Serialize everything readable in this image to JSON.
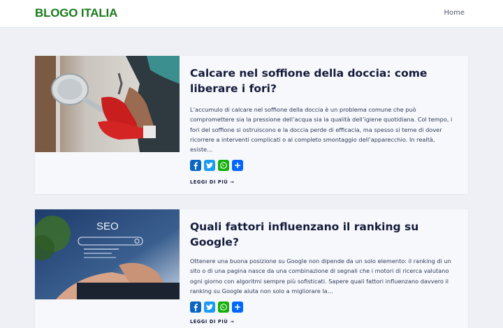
{
  "site": {
    "logo": "BLOGO ITALIA",
    "logo_color": "#1a7a1a",
    "nav": {
      "home": "Home"
    }
  },
  "posts": [
    {
      "title": "Calcare nel soffione della doccia: come liberare i fori?",
      "excerpt": "L’accumulo di calcare nel soffione della doccia è un problema comune che può compromettere sia la pressione dell’acqua sia la qualità dell’igiene quotidiana. Col tempo, i fori del soffione si ostruiscono e la doccia perde di efficacia, ma spesso si teme di dover ricorrere a interventi complicati o al completo smontaggio dell’apparecchio. In realtà, esiste…",
      "read_more": "LEGGI DI PIÙ →",
      "share": [
        "facebook-icon",
        "twitter-icon",
        "whatsapp-icon",
        "share-icon"
      ]
    },
    {
      "title": "Quali fattori influenzano il ranking su Google?",
      "excerpt": "Ottenere una buona posizione su Google non dipende da un solo elemento: il ranking di un sito o di una pagina nasce da una combinazione di segnali che i motori di ricerca valutano ogni giorno con algoritmi sempre più sofisticati. Sapere quali fattori influenzano davvero il ranking su Google aiuta non solo a migliorare la…",
      "read_more": "LEGGI DI PIÙ →",
      "image_text": "SEO",
      "share": [
        "facebook-icon",
        "twitter-icon",
        "whatsapp-icon",
        "share-icon"
      ]
    }
  ],
  "colors": {
    "facebook": "#0a66c2",
    "twitter": "#1d9bf0",
    "whatsapp": "#12af0a",
    "share": "#0166ff"
  }
}
